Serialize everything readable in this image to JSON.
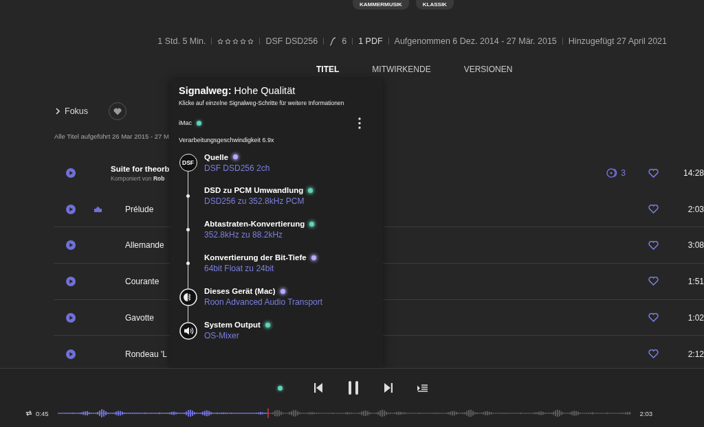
{
  "genre_tags": [
    {
      "label": "KAMMERMUSIK"
    },
    {
      "label": "KLASSIK"
    }
  ],
  "album_meta": {
    "duration": "1 Std. 5 Min.",
    "stars": 0,
    "format": "DSF DSD256",
    "versions": "6",
    "booklet": "1 PDF",
    "recorded": "Aufgenommen 6 Dez. 2014 - 27 Mär. 2015",
    "added": "Hinzugefügt 27 April 2021"
  },
  "tabs": [
    {
      "label": "TITEL",
      "selected": true
    },
    {
      "label": "MITWIRKENDE",
      "selected": false
    },
    {
      "label": "VERSIONEN",
      "selected": false
    }
  ],
  "focus": {
    "label": "Fokus",
    "favorite": false
  },
  "performed_note": "Alle Titel aufgeführt 26 Mar 2015 - 27 M",
  "work": {
    "title": "Suite for theorb",
    "composer_prefix": "Komponiert von",
    "composer": "Rob",
    "versions_count": "3",
    "duration": "14:28"
  },
  "tracks": [
    {
      "title": "Prélude",
      "duration": "2:03",
      "playing": true
    },
    {
      "title": "Allemande",
      "duration": "3:08",
      "playing": false
    },
    {
      "title": "Courante",
      "duration": "1:51",
      "playing": false
    },
    {
      "title": "Gavotte",
      "duration": "1:02",
      "playing": false
    },
    {
      "title": "Rondeau 'L",
      "duration": "2:12",
      "playing": false
    }
  ],
  "signal_path": {
    "title": "**Signalweg:** Hohe Qualität",
    "subtitle": "Klicke auf einzelne Signalweg-Schritte für weitere Informationen",
    "zone": "iMac",
    "speed": "Verarbeitungsgeschwindigkeit 6.9x",
    "steps": [
      {
        "kind": "source",
        "badge": "DSF",
        "title": "Quelle",
        "detail": "DSF DSD256 2ch",
        "color": "#b9a9ff"
      },
      {
        "kind": "step",
        "title": "DSD zu PCM Umwandlung",
        "detail": "DSD256 zu 352.8kHz PCM",
        "color": "#5fd3b6"
      },
      {
        "kind": "step",
        "title": "Abtastraten-Konvertierung",
        "detail": "352.8kHz zu 88.2kHz",
        "color": "#5fd3b6"
      },
      {
        "kind": "step",
        "title": "Konvertierung der Bit-Tiefe",
        "detail": "64bit Float zu 24bit",
        "color": "#b9a9ff"
      },
      {
        "kind": "device",
        "title": "Dieses Gerät (Mac)",
        "detail": "Roon Advanced Audio Transport",
        "color": "#b9a9ff"
      },
      {
        "kind": "output",
        "title": "System Output",
        "detail": "OS-Mixer",
        "color": "#5fd3b6"
      }
    ]
  },
  "player": {
    "playing": true,
    "elapsed": "0:45",
    "total": "2:03",
    "progress": {
      "level": 0.366
    }
  }
}
